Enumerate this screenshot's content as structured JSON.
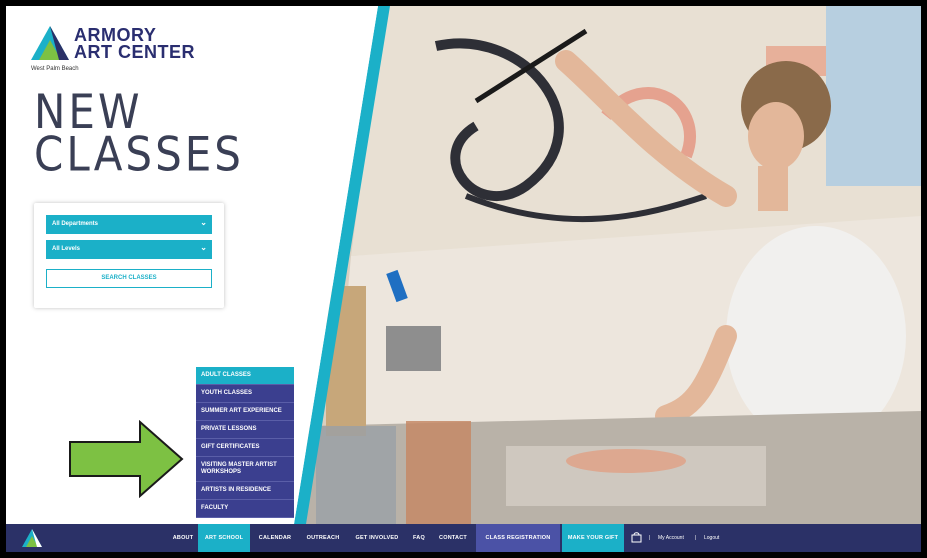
{
  "brand": {
    "line1": "ARMORY",
    "line2": "ART CENTER",
    "location": "West Palm Beach"
  },
  "hero": {
    "line1": "NEW",
    "line2": "CLASSES"
  },
  "search": {
    "department": "All Departments",
    "level": "All Levels",
    "button": "SEARCH CLASSES"
  },
  "submenu": [
    "ADULT CLASSES",
    "YOUTH CLASSES",
    "SUMMER ART EXPERIENCE",
    "PRIVATE LESSONS",
    "GIFT CERTIFICATES",
    "VISITING MASTER ARTIST WORKSHOPS",
    "ARTISTS IN RESIDENCE",
    "FACULTY"
  ],
  "nav": {
    "about": "ABOUT",
    "art_school": "ART SCHOOL",
    "calendar": "CALENDAR",
    "outreach": "OUTREACH",
    "get_involved": "GET INVOLVED",
    "faq": "FAQ",
    "contact": "CONTACT",
    "class_registration": "CLASS REGISTRATION",
    "make_your_gift": "MAKE YOUR GIFT",
    "sep1": "|",
    "my_account": "My Account",
    "sep2": "|",
    "logout": "Logout"
  },
  "colors": {
    "navy": "#2b3167",
    "teal": "#1bb0c8",
    "arrow": "#7dc143"
  }
}
